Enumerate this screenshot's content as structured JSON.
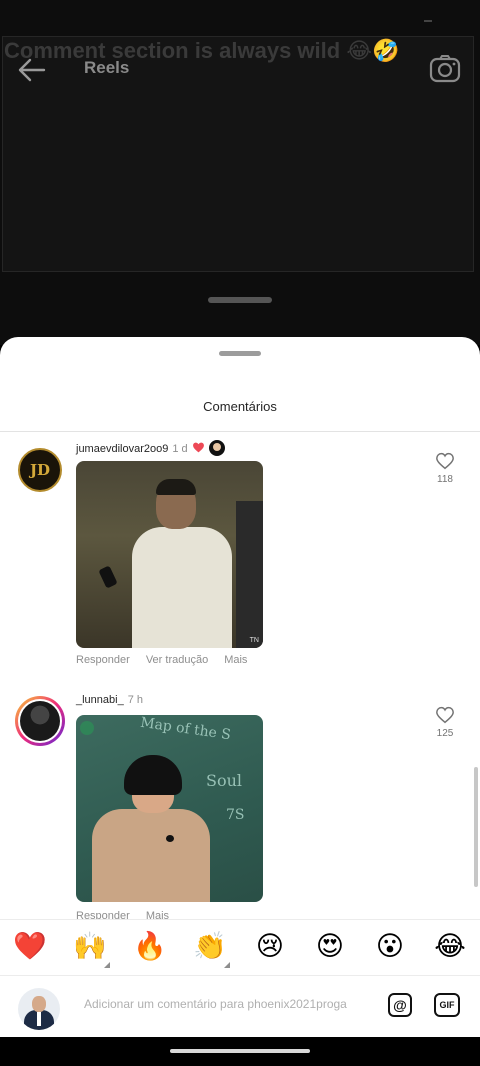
{
  "reels": {
    "caption": "Comment section is always wild 😂🤣",
    "title": "Reels"
  },
  "sheet": {
    "title": "Comentários"
  },
  "comments": [
    {
      "username": "jumaevdilovar2oo9",
      "time": "1 d",
      "avatar_initials": "JD",
      "gif_watermark": "TN",
      "actions": [
        "Responder",
        "Ver tradução",
        "Mais"
      ],
      "likes": "118"
    },
    {
      "username": "_lunnabi_",
      "time": "7 h",
      "gif_text": [
        "Map of the S",
        "Soul",
        "7S"
      ],
      "actions": [
        "Responder",
        "Mais"
      ],
      "likes": "125"
    }
  ],
  "emoji_bar": [
    "❤️",
    "🙌",
    "🔥",
    "👏",
    "😢",
    "😍",
    "😮",
    "😂"
  ],
  "input": {
    "placeholder": "Adicionar um comentário para phoenix2021proga",
    "mention_label": "@",
    "gif_label": "GIF"
  },
  "colors": {
    "heart_badge": "#ed4956",
    "sheet_bg": "#ffffff",
    "muted_text": "#8e8e8e"
  }
}
